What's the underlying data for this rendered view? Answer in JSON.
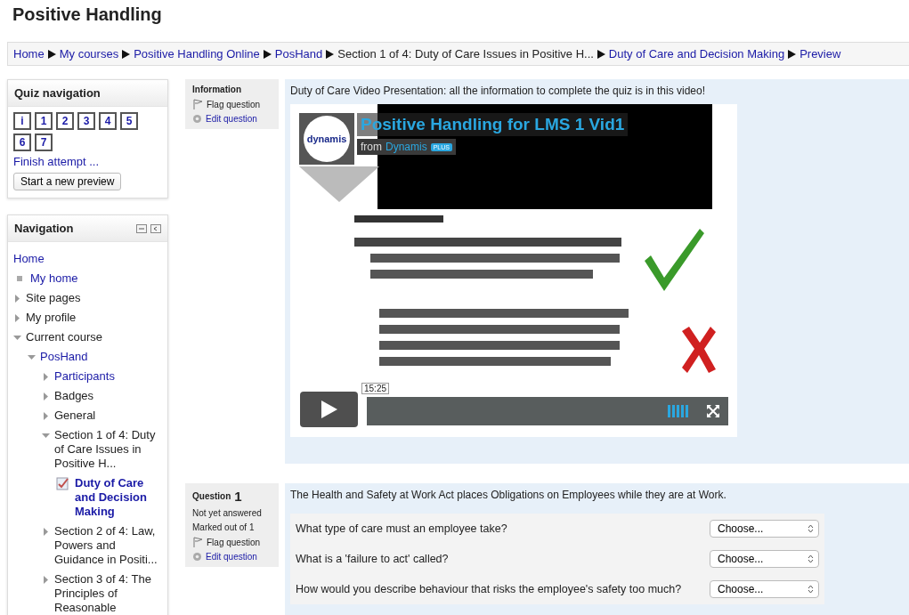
{
  "page_title": "Positive Handling",
  "breadcrumb": [
    {
      "label": "Home",
      "link": true
    },
    {
      "label": "My courses",
      "link": true
    },
    {
      "label": "Positive Handling Online",
      "link": true
    },
    {
      "label": "PosHand",
      "link": true
    },
    {
      "label": "Section 1 of 4: Duty of Care Issues in Positive H...",
      "link": false
    },
    {
      "label": "Duty of Care and Decision Making",
      "link": true
    },
    {
      "label": "Preview",
      "link": true
    }
  ],
  "quiz_navigation": {
    "title": "Quiz navigation",
    "buttons": [
      "i",
      "1",
      "2",
      "3",
      "4",
      "5",
      "6",
      "7"
    ],
    "finish_link": "Finish attempt ...",
    "new_preview_button": "Start a new preview"
  },
  "navigation": {
    "title": "Navigation",
    "items": [
      {
        "label": "Home",
        "kind": "root",
        "link": true
      },
      {
        "label": "My home",
        "kind": "bullet",
        "link": true
      },
      {
        "label": "Site pages",
        "kind": "branch",
        "expanded": false,
        "link": false
      },
      {
        "label": "My profile",
        "kind": "branch",
        "expanded": false,
        "link": false
      },
      {
        "label": "Current course",
        "kind": "branch",
        "expanded": true,
        "link": false,
        "children": [
          {
            "label": "PosHand",
            "kind": "branch",
            "expanded": true,
            "link": true,
            "children": [
              {
                "label": "Participants",
                "kind": "branch",
                "expanded": false,
                "link": true
              },
              {
                "label": "Badges",
                "kind": "branch",
                "expanded": false,
                "link": false
              },
              {
                "label": "General",
                "kind": "branch",
                "expanded": false,
                "link": false
              },
              {
                "label": "Section 1 of 4: Duty of Care Issues in Positive H...",
                "kind": "branch",
                "expanded": true,
                "link": false,
                "children": [
                  {
                    "label": "Duty of Care and Decision Making",
                    "kind": "activity",
                    "link": true
                  }
                ]
              },
              {
                "label": "Section 2 of 4: Law, Powers and Guidance in Positi...",
                "kind": "branch",
                "expanded": false,
                "link": false
              },
              {
                "label": "Section 3 of 4: The Principles of Reasonable",
                "kind": "branch",
                "expanded": false,
                "link": false
              }
            ]
          }
        ]
      }
    ]
  },
  "questions": [
    {
      "kind": "description",
      "info": {
        "title": "Information",
        "flag": "Flag question",
        "edit": "Edit question"
      },
      "text": "Duty of Care Video Presentation:  all the information to complete the quiz is in this video!",
      "video": {
        "kind": "picture",
        "title": "Positive Handling for LMS 1 Vid1",
        "from": "from",
        "channel": "Dynamis",
        "badge": "PLUS",
        "logo_text": "dynamis",
        "time": "15:25"
      }
    },
    {
      "kind": "match",
      "info": {
        "title": "Question",
        "number": "1",
        "status": "Not yet answered",
        "marks": "Marked out of 1",
        "flag": "Flag question",
        "edit": "Edit question"
      },
      "text": "The Health and Safety at Work Act places Obligations on Employees while they are at Work.",
      "items": [
        {
          "prompt": "What type of care must an employee take?",
          "choice": "Choose..."
        },
        {
          "prompt": "What is a 'failure to act' called?",
          "choice": "Choose..."
        },
        {
          "prompt": "How would you describe behaviour that risks the employee's safety too much?",
          "choice": "Choose..."
        }
      ]
    }
  ]
}
